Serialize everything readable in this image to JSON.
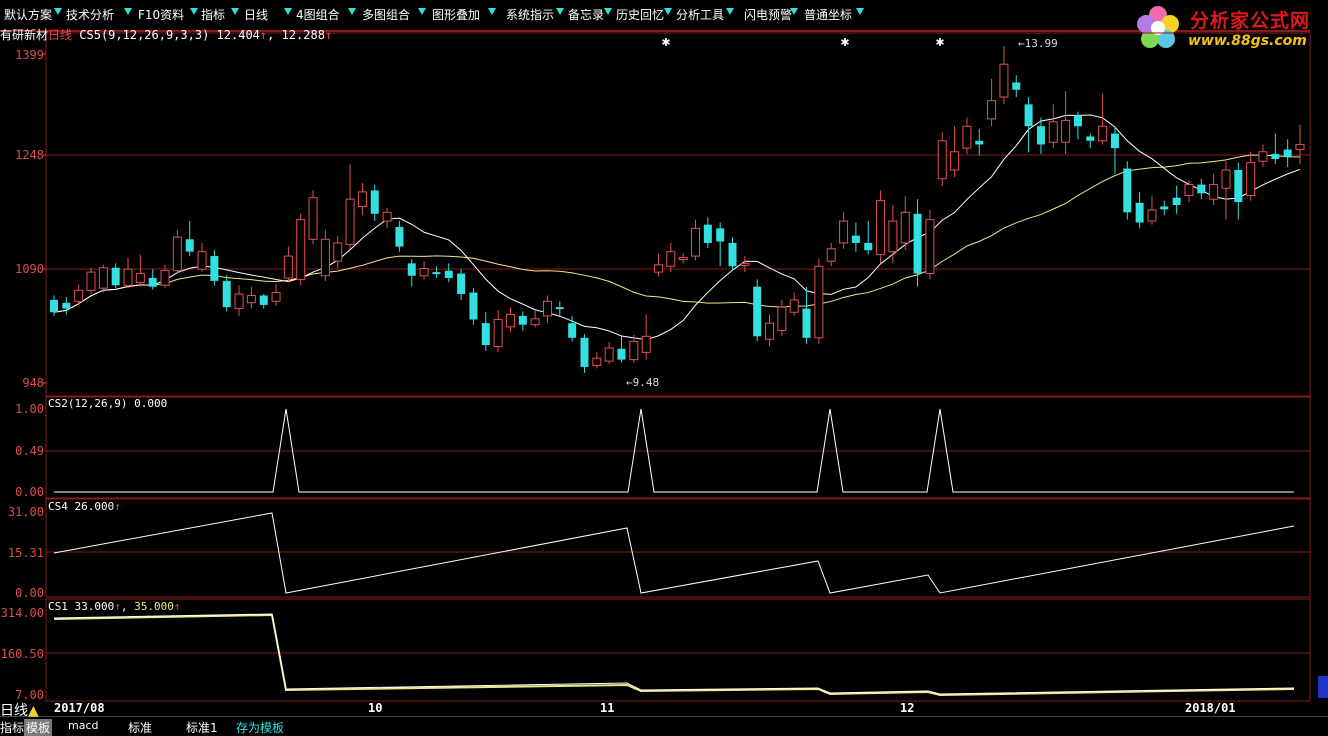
{
  "toolbar": {
    "items": [
      "默认方案",
      "技术分析",
      "F10资料",
      "指标",
      "日线",
      "4图组合",
      "多图组合",
      "图形叠加",
      "系统指示",
      "备忘录",
      "历史回忆",
      "分析工具",
      "闪电预警",
      "普通坐标"
    ]
  },
  "logo": {
    "title": "分析家公式网",
    "url": "www.88gs.com"
  },
  "header": {
    "stock": "有研新材",
    "period": "日线",
    "indicator_text": "CS5(9,12,26,9,3,3)",
    "val1": "12.404",
    "val2": "12.288"
  },
  "markers": {
    "high_label": "13.99",
    "low_label": "9.48"
  },
  "pane1": {
    "yticks": [
      "1399",
      "1248",
      "1090",
      "948"
    ]
  },
  "pane2": {
    "label": "CS2(12,26,9)",
    "value": "0.000",
    "yticks": [
      "1.00",
      "0.49",
      "0.00"
    ]
  },
  "pane3": {
    "label": "CS4",
    "value": "26.000",
    "yticks": [
      "31.00",
      "15.31",
      "0.00"
    ]
  },
  "pane4": {
    "label": "CS1",
    "value1": "33.000",
    "value2": "35.000",
    "yticks": [
      "314.00",
      "160.50",
      "7.00"
    ]
  },
  "xaxis": {
    "labels": [
      "2017/08",
      "10",
      "11",
      "12",
      "2018/01"
    ]
  },
  "bottom": {
    "left_label": "日线",
    "tabs": [
      "指标",
      "模板",
      "macd",
      "标准",
      "标准1",
      "存为模板"
    ]
  },
  "colors": {
    "up": "#e05050",
    "down": "#33e0e0",
    "ma1": "#ffffff",
    "ma2": "#f0e68c",
    "grid": "#8b1a1a"
  },
  "chart_data": {
    "type": "candlestick",
    "ylim": [
      948,
      1399
    ],
    "candles": [
      [
        1062,
        1045,
        1068,
        1040
      ],
      [
        1058,
        1050,
        1066,
        1042
      ],
      [
        1060,
        1075,
        1083,
        1055
      ],
      [
        1075,
        1100,
        1106,
        1070
      ],
      [
        1078,
        1106,
        1110,
        1072
      ],
      [
        1106,
        1082,
        1112,
        1078
      ],
      [
        1082,
        1104,
        1120,
        1078
      ],
      [
        1086,
        1098,
        1124,
        1080
      ],
      [
        1092,
        1080,
        1104,
        1076
      ],
      [
        1082,
        1102,
        1110,
        1078
      ],
      [
        1102,
        1148,
        1158,
        1098
      ],
      [
        1145,
        1128,
        1170,
        1122
      ],
      [
        1104,
        1128,
        1140,
        1100
      ],
      [
        1122,
        1088,
        1130,
        1082
      ],
      [
        1088,
        1052,
        1096,
        1046
      ],
      [
        1050,
        1070,
        1082,
        1040
      ],
      [
        1058,
        1068,
        1080,
        1050
      ],
      [
        1068,
        1055,
        1070,
        1050
      ],
      [
        1060,
        1072,
        1084,
        1054
      ],
      [
        1092,
        1122,
        1135,
        1086
      ],
      [
        1090,
        1172,
        1180,
        1082
      ],
      [
        1145,
        1202,
        1212,
        1138
      ],
      [
        1095,
        1145,
        1158,
        1088
      ],
      [
        1115,
        1140,
        1150,
        1105
      ],
      [
        1138,
        1200,
        1248,
        1132
      ],
      [
        1190,
        1210,
        1222,
        1178
      ],
      [
        1212,
        1180,
        1220,
        1170
      ],
      [
        1170,
        1182,
        1188,
        1160
      ],
      [
        1162,
        1135,
        1170,
        1128
      ],
      [
        1112,
        1095,
        1118,
        1080
      ],
      [
        1095,
        1105,
        1115,
        1090
      ],
      [
        1100,
        1098,
        1108,
        1092
      ],
      [
        1102,
        1092,
        1112,
        1086
      ],
      [
        1098,
        1070,
        1104,
        1062
      ],
      [
        1072,
        1035,
        1078,
        1028
      ],
      [
        1030,
        1000,
        1045,
        992
      ],
      [
        998,
        1035,
        1048,
        990
      ],
      [
        1025,
        1042,
        1052,
        1018
      ],
      [
        1040,
        1028,
        1046,
        1020
      ],
      [
        1028,
        1036,
        1048,
        1024
      ],
      [
        1040,
        1060,
        1068,
        1030
      ],
      [
        1052,
        1050,
        1060,
        1040
      ],
      [
        1030,
        1010,
        1040,
        1005
      ],
      [
        1010,
        970,
        1015,
        962
      ],
      [
        972,
        982,
        990,
        968
      ],
      [
        978,
        996,
        1004,
        974
      ],
      [
        995,
        980,
        1012,
        976
      ],
      [
        980,
        1005,
        1014,
        976
      ],
      [
        990,
        1012,
        1042,
        980
      ],
      [
        1100,
        1110,
        1125,
        1094
      ],
      [
        1108,
        1128,
        1140,
        1100
      ],
      [
        1120,
        1120,
        1126,
        1112
      ],
      [
        1122,
        1160,
        1172,
        1116
      ],
      [
        1165,
        1140,
        1175,
        1133
      ],
      [
        1160,
        1142,
        1168,
        1108
      ],
      [
        1140,
        1108,
        1148,
        1102
      ],
      [
        1110,
        1112,
        1122,
        1100
      ],
      [
        1080,
        1012,
        1090,
        1005
      ],
      [
        1008,
        1030,
        1042,
        998
      ],
      [
        1020,
        1052,
        1062,
        1012
      ],
      [
        1045,
        1062,
        1072,
        1040
      ],
      [
        1050,
        1010,
        1080,
        1002
      ],
      [
        1010,
        1108,
        1118,
        1002
      ],
      [
        1115,
        1132,
        1140,
        1108
      ],
      [
        1140,
        1170,
        1182,
        1132
      ],
      [
        1150,
        1140,
        1168,
        1128
      ],
      [
        1140,
        1130,
        1170,
        1124
      ],
      [
        1124,
        1198,
        1212,
        1112
      ],
      [
        1128,
        1170,
        1192,
        1112
      ],
      [
        1140,
        1182,
        1204,
        1130
      ],
      [
        1180,
        1098,
        1200,
        1080
      ],
      [
        1098,
        1172,
        1185,
        1090
      ],
      [
        1228,
        1280,
        1292,
        1218
      ],
      [
        1240,
        1265,
        1300,
        1230
      ],
      [
        1270,
        1300,
        1312,
        1262
      ],
      [
        1280,
        1275,
        1296,
        1260
      ],
      [
        1310,
        1335,
        1365,
        1300
      ],
      [
        1340,
        1385,
        1410,
        1330
      ],
      [
        1360,
        1350,
        1370,
        1340
      ],
      [
        1330,
        1300,
        1340,
        1264
      ],
      [
        1300,
        1275,
        1312,
        1262
      ],
      [
        1278,
        1306,
        1330,
        1270
      ],
      [
        1278,
        1308,
        1348,
        1262
      ],
      [
        1315,
        1300,
        1320,
        1282
      ],
      [
        1286,
        1280,
        1290,
        1270
      ],
      [
        1280,
        1300,
        1345,
        1275
      ],
      [
        1290,
        1270,
        1300,
        1235
      ],
      [
        1242,
        1182,
        1252,
        1172
      ],
      [
        1195,
        1168,
        1210,
        1160
      ],
      [
        1170,
        1185,
        1205,
        1165
      ],
      [
        1190,
        1186,
        1198,
        1178
      ],
      [
        1202,
        1192,
        1218,
        1180
      ],
      [
        1205,
        1220,
        1226,
        1196
      ],
      [
        1220,
        1208,
        1228,
        1200
      ],
      [
        1200,
        1220,
        1235,
        1192
      ],
      [
        1215,
        1240,
        1252,
        1172
      ],
      [
        1240,
        1196,
        1250,
        1172
      ],
      [
        1205,
        1250,
        1265,
        1198
      ],
      [
        1252,
        1265,
        1275,
        1244
      ],
      [
        1262,
        1255,
        1290,
        1248
      ],
      [
        1268,
        1258,
        1282,
        1244
      ],
      [
        1268,
        1275,
        1302,
        1248
      ]
    ]
  }
}
